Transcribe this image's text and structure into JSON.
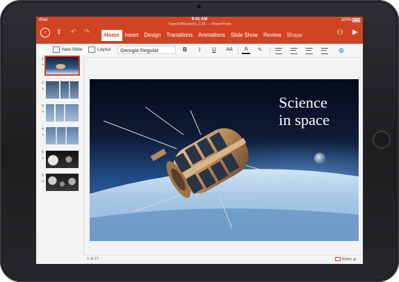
{
  "status_bar": {
    "carrier": "iPad",
    "time": "9:41 AM",
    "battery": "100%"
  },
  "document_title": "TypesOfRockets_2.25 — PowerPoint",
  "tabs": [
    "Home",
    "Insert",
    "Design",
    "Transitions",
    "Animations",
    "Slide Show",
    "Review",
    "Shape"
  ],
  "active_tab": "Home",
  "ribbon": {
    "new_slide_label": "New Slide",
    "layout_label": "Layout",
    "font_name": "Georgia Regular",
    "bold": "B",
    "italic": "I",
    "underline": "U",
    "font_size_glyph": "AA",
    "font_color_glyph": "A"
  },
  "thumbnails": [
    {
      "number": "1",
      "marker": "★",
      "selected": true
    },
    {
      "number": "2",
      "marker": "★",
      "selected": false
    },
    {
      "number": "3",
      "marker": "★",
      "selected": false
    },
    {
      "number": "4",
      "marker": "★",
      "selected": false
    },
    {
      "number": "5",
      "marker": "★",
      "selected": false
    },
    {
      "number": "6",
      "marker": "★",
      "selected": false
    }
  ],
  "slide": {
    "title": "Science\nin space"
  },
  "footer": {
    "page_count": "1 of 17",
    "notes_label": "Notes"
  },
  "colors": {
    "accent": "#d04424",
    "device": "#232427",
    "screen_bg": "#f3f3f3"
  }
}
